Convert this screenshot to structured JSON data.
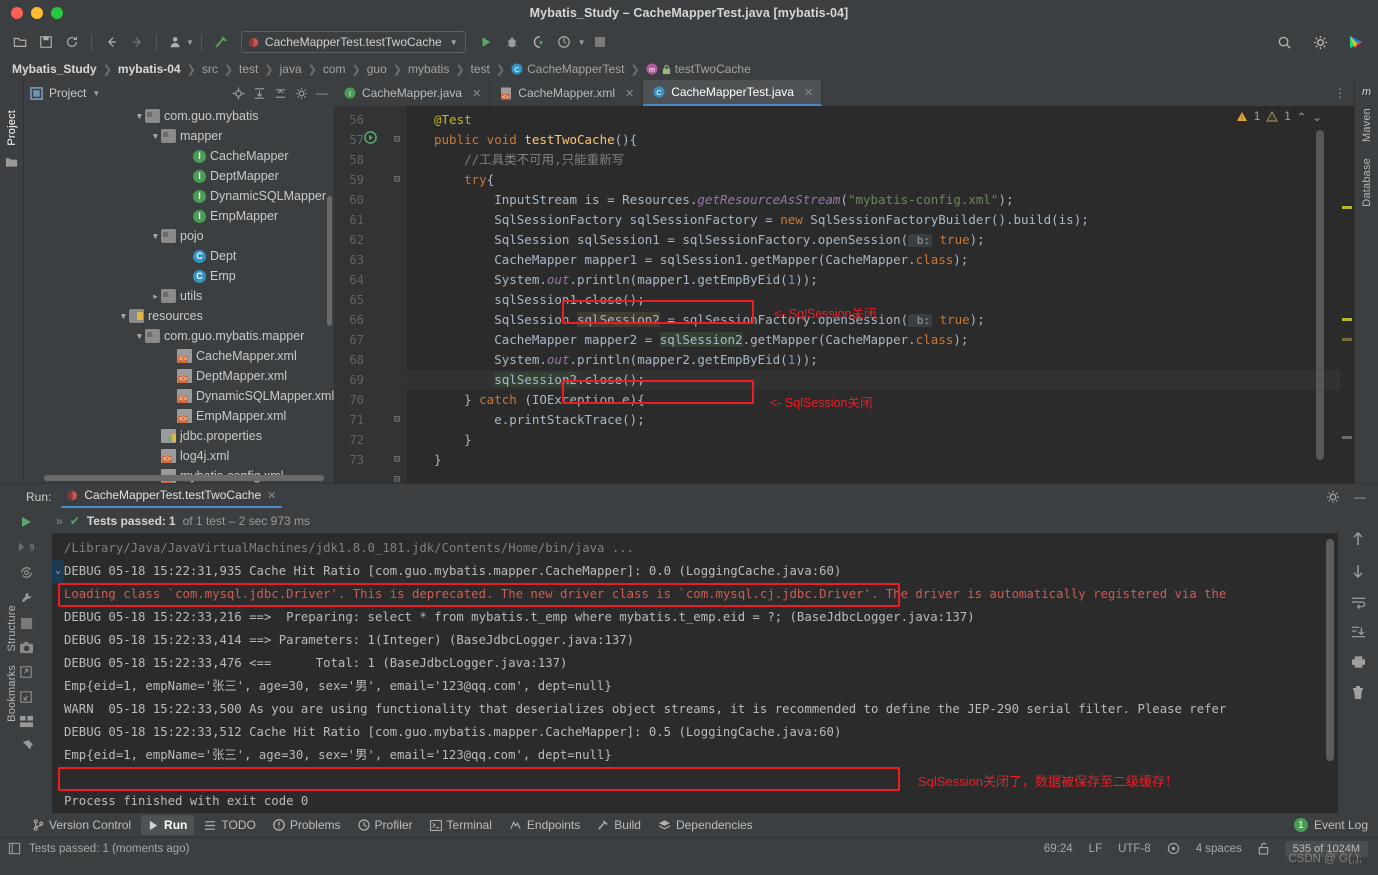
{
  "window": {
    "title": "Mybatis_Study – CacheMapperTest.java [mybatis-04]"
  },
  "toolbar": {
    "icons": [
      "open-folder-icon",
      "save-icon",
      "sync-icon",
      "back-arrow-icon",
      "forward-arrow-icon",
      "profile-icon",
      "build-hammer-icon"
    ],
    "run_config": "CacheMapperTest.testTwoCache",
    "run_label": "run-icon",
    "debug_label": "debug-icon",
    "coverage_label": "coverage-icon",
    "profiler_label": "profiler-icon",
    "stop_label": "stop-icon",
    "search_label": "search-icon",
    "settings_label": "gear-icon",
    "updates_label": "idea-logo-icon"
  },
  "breadcrumbs": [
    "Mybatis_Study",
    "mybatis-04",
    "src",
    "test",
    "java",
    "com",
    "guo",
    "mybatis",
    "test",
    "CacheMapperTest",
    "testTwoCache"
  ],
  "left_strip": {
    "project_label": "Project",
    "structure_label": "Structure",
    "bookmarks_label": "Bookmarks"
  },
  "right_strip": {
    "maven_label": "Maven",
    "database_label": "Database"
  },
  "project_panel": {
    "title": "Project",
    "tree": [
      {
        "indent": 3,
        "arrow": "down",
        "icon": "package-icon",
        "label": "com.guo.mybatis"
      },
      {
        "indent": 4,
        "arrow": "down",
        "icon": "package-icon",
        "label": "mapper"
      },
      {
        "indent": 5,
        "arrow": "none",
        "icon": "interface-icon",
        "label": "CacheMapper"
      },
      {
        "indent": 5,
        "arrow": "none",
        "icon": "interface-icon",
        "label": "DeptMapper"
      },
      {
        "indent": 5,
        "arrow": "none",
        "icon": "interface-icon",
        "label": "DynamicSQLMapper"
      },
      {
        "indent": 5,
        "arrow": "none",
        "icon": "interface-icon",
        "label": "EmpMapper"
      },
      {
        "indent": 4,
        "arrow": "down",
        "icon": "package-icon",
        "label": "pojo"
      },
      {
        "indent": 5,
        "arrow": "none",
        "icon": "class-icon",
        "label": "Dept"
      },
      {
        "indent": 5,
        "arrow": "none",
        "icon": "class-icon",
        "label": "Emp"
      },
      {
        "indent": 4,
        "arrow": "right",
        "icon": "package-icon",
        "label": "utils"
      },
      {
        "indent": 2,
        "arrow": "down",
        "icon": "resources-folder-icon",
        "label": "resources"
      },
      {
        "indent": 3,
        "arrow": "down",
        "icon": "package-icon",
        "label": "com.guo.mybatis.mapper"
      },
      {
        "indent": 4,
        "arrow": "none",
        "icon": "xml-file-icon",
        "label": "CacheMapper.xml"
      },
      {
        "indent": 4,
        "arrow": "none",
        "icon": "xml-file-icon",
        "label": "DeptMapper.xml"
      },
      {
        "indent": 4,
        "arrow": "none",
        "icon": "xml-file-icon",
        "label": "DynamicSQLMapper.xml"
      },
      {
        "indent": 4,
        "arrow": "none",
        "icon": "xml-file-icon",
        "label": "EmpMapper.xml"
      },
      {
        "indent": 3,
        "arrow": "none",
        "icon": "properties-file-icon",
        "label": "jdbc.properties"
      },
      {
        "indent": 3,
        "arrow": "none",
        "icon": "xml-file-icon",
        "label": "log4j.xml"
      },
      {
        "indent": 3,
        "arrow": "none",
        "icon": "xml-file-icon",
        "label": "mybatis-config.xml"
      }
    ]
  },
  "editor": {
    "tabs": [
      {
        "label": "CacheMapper.java",
        "icon": "interface-icon",
        "active": false
      },
      {
        "label": "CacheMapper.xml",
        "icon": "xml-file-icon",
        "active": false
      },
      {
        "label": "CacheMapperTest.java",
        "icon": "class-icon",
        "active": true
      }
    ],
    "inspection": {
      "warnings": "1",
      "weak_warnings": "1"
    },
    "first_line_number": 56,
    "lines": [
      {
        "n": 56,
        "text": "    @Test"
      },
      {
        "n": 57,
        "text": "    public void testTwoCache(){"
      },
      {
        "n": 58,
        "text": "        //工具类不可用,只能重新写"
      },
      {
        "n": 59,
        "text": "        try{"
      },
      {
        "n": 60,
        "text": "            InputStream is = Resources.getResourceAsStream(\"mybatis-config.xml\");"
      },
      {
        "n": 61,
        "text": "            SqlSessionFactory sqlSessionFactory = new SqlSessionFactoryBuilder().build(is);"
      },
      {
        "n": 62,
        "text": "            SqlSession sqlSession1 = sqlSessionFactory.openSession( b: true);"
      },
      {
        "n": 63,
        "text": "            CacheMapper mapper1 = sqlSession1.getMapper(CacheMapper.class);"
      },
      {
        "n": 64,
        "text": "            System.out.println(mapper1.getEmpByEid(1));"
      },
      {
        "n": 65,
        "text": "            sqlSession1.close();"
      },
      {
        "n": 66,
        "text": "            SqlSession sqlSession2 = sqlSessionFactory.openSession( b: true);"
      },
      {
        "n": 67,
        "text": "            CacheMapper mapper2 = sqlSession2.getMapper(CacheMapper.class);"
      },
      {
        "n": 68,
        "text": "            System.out.println(mapper2.getEmpByEid(1));"
      },
      {
        "n": 69,
        "text": "            sqlSession2.close();"
      },
      {
        "n": 70,
        "text": "        } catch (IOException e){"
      },
      {
        "n": 71,
        "text": "            e.printStackTrace();"
      },
      {
        "n": 72,
        "text": "        }"
      },
      {
        "n": 73,
        "text": "    }"
      }
    ],
    "annotations": [
      {
        "text": "<- SqlSession关闭",
        "line": 65
      },
      {
        "text": "<- SqlSession关闭",
        "line": 69
      }
    ]
  },
  "run_window": {
    "label": "Run:",
    "tab": "CacheMapperTest.testTwoCache",
    "status": {
      "passed_prefix": "Tests passed:",
      "passed_count": "1",
      "rest": "of 1 test – 2 sec 973 ms"
    },
    "console": [
      {
        "text": "/Library/Java/JavaVirtualMachines/jdk1.8.0_181.jdk/Contents/Home/bin/java ...",
        "style": "link"
      },
      {
        "text": "DEBUG 05-18 15:22:31,935 Cache Hit Ratio [com.guo.mybatis.mapper.CacheMapper]: 0.0 (LoggingCache.java:60)",
        "style": "normal"
      },
      {
        "text": "Loading class `com.mysql.jdbc.Driver'. This is deprecated. The new driver class is `com.mysql.cj.jdbc.Driver'. The driver is automatically registered via the",
        "style": "err"
      },
      {
        "text": "DEBUG 05-18 15:22:33,216 ==>  Preparing: select * from mybatis.t_emp where mybatis.t_emp.eid = ?; (BaseJdbcLogger.java:137)",
        "style": "normal"
      },
      {
        "text": "DEBUG 05-18 15:22:33,414 ==> Parameters: 1(Integer) (BaseJdbcLogger.java:137)",
        "style": "normal"
      },
      {
        "text": "DEBUG 05-18 15:22:33,476 <==      Total: 1 (BaseJdbcLogger.java:137)",
        "style": "normal"
      },
      {
        "text": "Emp{eid=1, empName='张三', age=30, sex='男', email='123@qq.com', dept=null}",
        "style": "normal"
      },
      {
        "text": "WARN  05-18 15:22:33,500 As you are using functionality that deserializes object streams, it is recommended to define the JEP-290 serial filter. Please refer",
        "style": "normal"
      },
      {
        "text": "DEBUG 05-18 15:22:33,512 Cache Hit Ratio [com.guo.mybatis.mapper.CacheMapper]: 0.5 (LoggingCache.java:60)",
        "style": "normal"
      },
      {
        "text": "Emp{eid=1, empName='张三', age=30, sex='男', email='123@qq.com', dept=null}",
        "style": "normal"
      },
      {
        "text": "",
        "style": "normal"
      },
      {
        "text": "Process finished with exit code 0",
        "style": "normal"
      }
    ],
    "annotation": "SqlSession关闭了，数据被保存至二级缓存！",
    "gutter_icons": [
      "rerun-icon",
      "rerun-failed-icon",
      "toggle-auto-test-icon",
      "settings-wrench-icon",
      "stop-icon",
      "screenshot-icon",
      "export-icon",
      "import-icon",
      "layout-icon",
      "pin-icon"
    ],
    "side_icons": [
      "scroll-up-icon",
      "scroll-down-icon",
      "soft-wrap-icon",
      "scroll-to-end-icon",
      "print-icon",
      "trash-icon"
    ]
  },
  "bottom_toolbar": {
    "items": [
      {
        "label": "Version Control",
        "icon": "branch-icon",
        "active": false
      },
      {
        "label": "Run",
        "icon": "run-icon",
        "active": true
      },
      {
        "label": "TODO",
        "icon": "list-icon",
        "active": false
      },
      {
        "label": "Problems",
        "icon": "error-icon",
        "active": false
      },
      {
        "label": "Profiler",
        "icon": "profiler-icon",
        "active": false
      },
      {
        "label": "Terminal",
        "icon": "terminal-icon",
        "active": false
      },
      {
        "label": "Endpoints",
        "icon": "endpoints-icon",
        "active": false
      },
      {
        "label": "Build",
        "icon": "hammer-icon",
        "active": false
      },
      {
        "label": "Dependencies",
        "icon": "layers-icon",
        "active": false
      }
    ],
    "event_log": {
      "label": "Event Log",
      "count": "1"
    }
  },
  "statusbar": {
    "message": "Tests passed: 1 (moments ago)",
    "caret": "69:24",
    "line_sep": "LF",
    "encoding": "UTF-8",
    "indent": "4 spaces",
    "memory": "535 of 1024M",
    "lock_icon": "unlocked-icon",
    "inspection_icon": "eye-icon"
  },
  "watermark": "CSDN @ G(,);",
  "colors": {
    "accent_blue": "#4a88c7",
    "red_highlight": "#ee1c25",
    "green_run": "#499c54",
    "bg_panel": "#3c3f41",
    "bg_editor": "#2b2b2b"
  }
}
